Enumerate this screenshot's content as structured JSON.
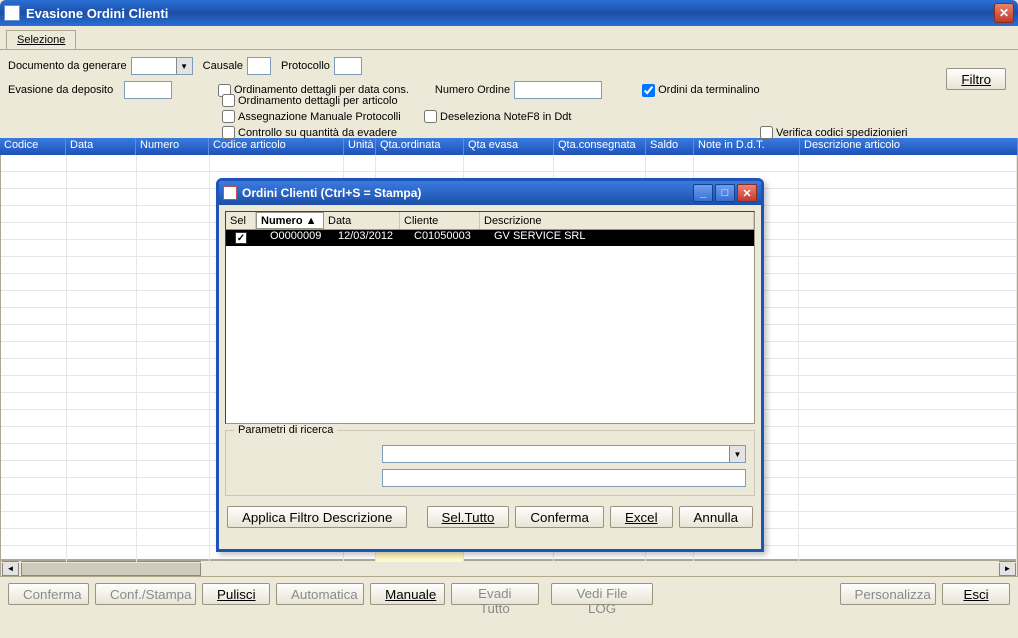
{
  "window": {
    "title": "Evasione Ordini Clienti"
  },
  "tabs": {
    "selezione": "Selezione"
  },
  "form": {
    "documento_label": "Documento da generare",
    "causale_label": "Causale",
    "protocollo_label": "Protocollo",
    "evasione_label": "Evasione da deposito",
    "chk_ord_data": "Ordinamento dettagli per data cons.",
    "chk_ord_articolo": "Ordinamento dettagli per articolo",
    "chk_asseg_manuale": "Assegnazione Manuale Protocolli",
    "chk_controllo_qta": "Controllo su quantità da evadere",
    "numero_ordine_label": "Numero Ordine",
    "chk_desel_note": "Deseleziona NoteF8 in Ddt",
    "chk_ordini_terminalino": "Ordini da terminalino",
    "chk_verifica_sped": "Verifica codici spedizionieri",
    "filtro_btn": "Filtro"
  },
  "grid": {
    "headers": [
      "Codice",
      "Data",
      "Numero",
      "Codice articolo",
      "Unità",
      "Qta.ordinata",
      "Qta evasa",
      "Qta.consegnata",
      "Saldo",
      "Note in D.d.T.",
      "Descrizione articolo"
    ]
  },
  "modal": {
    "title": "Ordini Clienti (Ctrl+S = Stampa)",
    "headers": {
      "sel": "Sel",
      "numero": "Numero",
      "sort": "▲",
      "data": "Data",
      "cliente": "Cliente",
      "descrizione": "Descrizione"
    },
    "row": {
      "numero": "O0000009",
      "data": "12/03/2012",
      "cliente": "C01050003",
      "descrizione": "GV SERVICE SRL"
    },
    "parametri_label": "Parametri di ricerca",
    "btn_applica": "Applica Filtro Descrizione",
    "btn_sel_tutto": "Sel.Tutto",
    "btn_conferma": "Conferma",
    "btn_excel": "Excel",
    "btn_annulla": "Annulla"
  },
  "bottom": {
    "conferma": "Conferma",
    "conf_stampa": "Conf./Stampa",
    "pulisci": "Pulisci",
    "automatica": "Automatica",
    "manuale": "Manuale",
    "evadi_tutto": "Evadi Tutto",
    "vedi_log": "Vedi File LOG",
    "personalizza": "Personalizza",
    "esci": "Esci"
  }
}
